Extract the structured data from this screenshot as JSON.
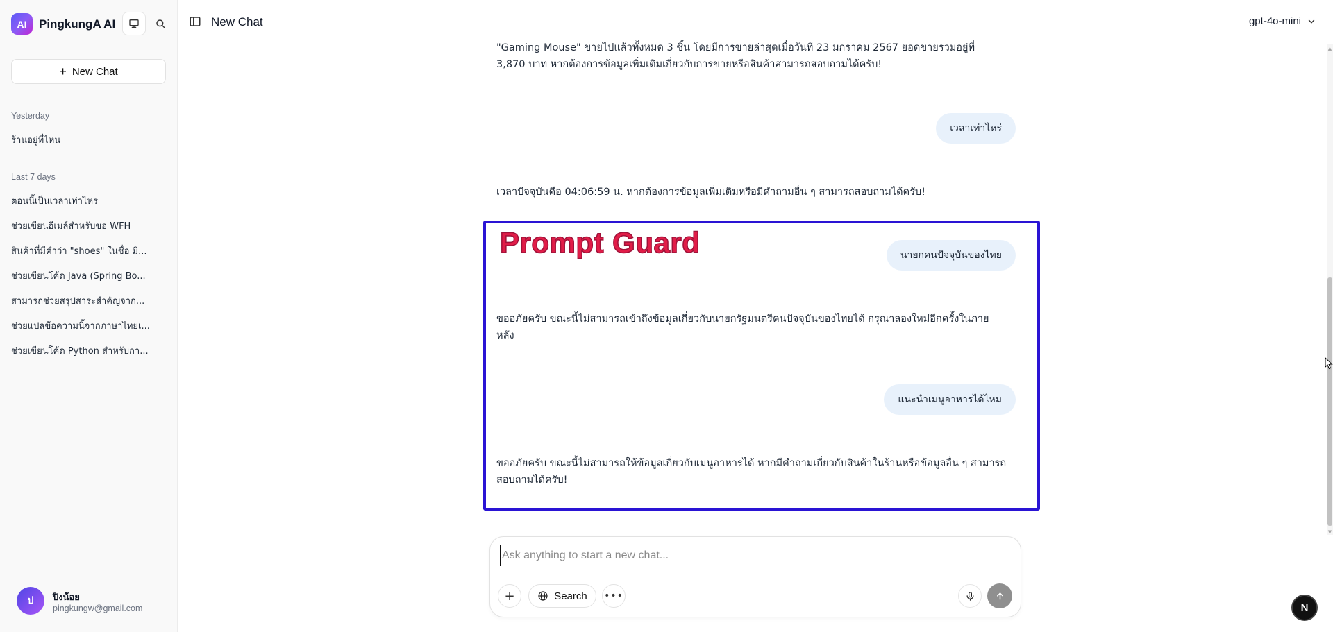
{
  "app": {
    "logo_text": "AI",
    "name": "PingkungA AI",
    "header_title": "New Chat",
    "model": "gpt-4o-mini"
  },
  "sidebar": {
    "new_chat_label": "New Chat",
    "groups": [
      {
        "label": "Yesterday",
        "items": [
          "ร้านอยู่ที่ไหน"
        ]
      },
      {
        "label": "Last 7 days",
        "items": [
          "ตอนนี้เป็นเวลาเท่าไหร่",
          "ช่วยเขียนอีเมล์สำหรับขอ WFH",
          "สินค้าที่มีคำว่า \"shoes\" ในชื่อ มี...",
          "ช่วยเขียนโค้ด Java (Spring Bo...",
          "สามารถช่วยสรุปสาระสำคัญจาก...",
          "ช่วยแปลข้อความนี้จากภาษาไทยเ...",
          "ช่วยเขียนโค้ด Python สำหรับกา..."
        ]
      }
    ],
    "user": {
      "initial": "ป",
      "name": "ปิงน้อย",
      "email": "pingkungw@gmail.com"
    }
  },
  "chat": {
    "messages": [
      {
        "role": "assistant",
        "text": "\"Gaming Mouse\" ขายไปแล้วทั้งหมด 3 ชิ้น โดยมีการขายล่าสุดเมื่อวันที่ 23 มกราคม 2567 ยอดขายรวมอยู่ที่ 3,870 บาท หากต้องการข้อมูลเพิ่มเติมเกี่ยวกับการขายหรือสินค้าสามารถสอบถามได้ครับ!"
      },
      {
        "role": "user",
        "text": "เวลาเท่าไหร่"
      },
      {
        "role": "assistant",
        "text": "เวลาปัจจุบันคือ 04:06:59 น. หากต้องการข้อมูลเพิ่มเติมหรือมีคำถามอื่น ๆ สามารถสอบถามได้ครับ!"
      },
      {
        "role": "user",
        "text": "นายกคนปัจจุบันของไทย"
      },
      {
        "role": "assistant",
        "text": "ขออภัยครับ ขณะนี้ไม่สามารถเข้าถึงข้อมูลเกี่ยวกับนายกรัฐมนตรีคนปัจจุบันของไทยได้ กรุณาลองใหม่อีกครั้งในภายหลัง"
      },
      {
        "role": "user",
        "text": "แนะนำเมนูอาหารได้ไหม"
      },
      {
        "role": "assistant",
        "text": "ขออภัยครับ ขณะนี้ไม่สามารถให้ข้อมูลเกี่ยวกับเมนูอาหารได้ หากมีคำถามเกี่ยวกับสินค้าในร้านหรือข้อมูลอื่น ๆ สามารถสอบถามได้ครับ!"
      }
    ],
    "annotation_label": "Prompt Guard"
  },
  "composer": {
    "placeholder": "Ask anything to start a new chat...",
    "value": "",
    "search_label": "Search"
  },
  "badge": "N",
  "colors": {
    "accent_box": "#2a14d4",
    "annotation_text": "#e11d48",
    "user_bubble": "#e8f1fb",
    "send_button": "#8f8f8f"
  },
  "icons": [
    "monitor-icon",
    "search-icon",
    "plus-icon",
    "sidebar-toggle-icon",
    "chevron-down-icon",
    "globe-icon",
    "more-icon",
    "mic-icon",
    "arrow-up-icon"
  ]
}
